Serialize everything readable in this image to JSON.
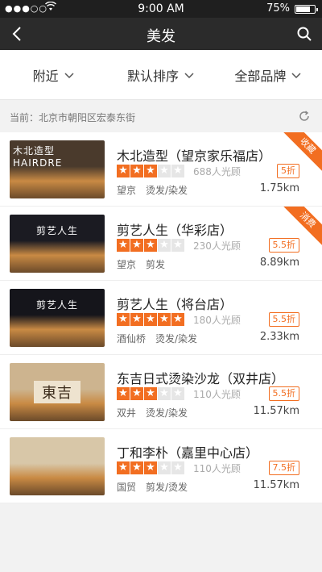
{
  "status_bar": {
    "signal": "●●●○○",
    "time": "9:00 AM",
    "battery": "75%",
    "battery_level": 0.75
  },
  "nav": {
    "title": "美发"
  },
  "filters": [
    {
      "label": "附近"
    },
    {
      "label": "默认排序"
    },
    {
      "label": "全部品牌"
    }
  ],
  "location": {
    "text": "当前：北京市朝阳区宏泰东街"
  },
  "colors": {
    "accent": "#f26e21",
    "navbar": "#2b2b2b",
    "statusbar": "#1f1f1f"
  },
  "shops": [
    {
      "name": "木北造型（望京家乐福店）",
      "rating": 3,
      "reviews": "688人光顾",
      "discount": "5折",
      "area": "望京",
      "services": "烫发/染发",
      "distance": "1.75km",
      "ribbon": "收藏",
      "thumb_sign": "木北造型 HAIRDRE",
      "thumb_color": "#4a3a2c"
    },
    {
      "name": "剪艺人生（华彩店）",
      "rating": 3,
      "reviews": "230人光顾",
      "discount": "5.5折",
      "area": "望京",
      "services": "剪发",
      "distance": "8.89km",
      "ribbon": "消费",
      "thumb_sign": "剪艺人生",
      "thumb_color": "#1b1b22"
    },
    {
      "name": "剪艺人生（将台店）",
      "rating": 5,
      "reviews": "180人光顾",
      "discount": "5.5折",
      "area": "酒仙桥",
      "services": "烫发/染发",
      "distance": "2.33km",
      "ribbon": "",
      "thumb_sign": "剪艺人生",
      "thumb_color": "#15151b"
    },
    {
      "name": "东吉日式烫染沙龙（双井店）",
      "rating": 3,
      "reviews": "110人光顾",
      "discount": "5.5折",
      "area": "双井",
      "services": "烫发/染发",
      "distance": "11.57km",
      "ribbon": "",
      "thumb_sign": "東吉",
      "thumb_color": "#cdb48f"
    },
    {
      "name": "丁和李朴（嘉里中心店）",
      "rating": 3,
      "reviews": "110人光顾",
      "discount": "7.5折",
      "area": "国贸",
      "services": "剪发/烫发",
      "distance": "11.57km",
      "ribbon": "",
      "thumb_sign": "",
      "thumb_color": "#d8c7a8"
    }
  ]
}
